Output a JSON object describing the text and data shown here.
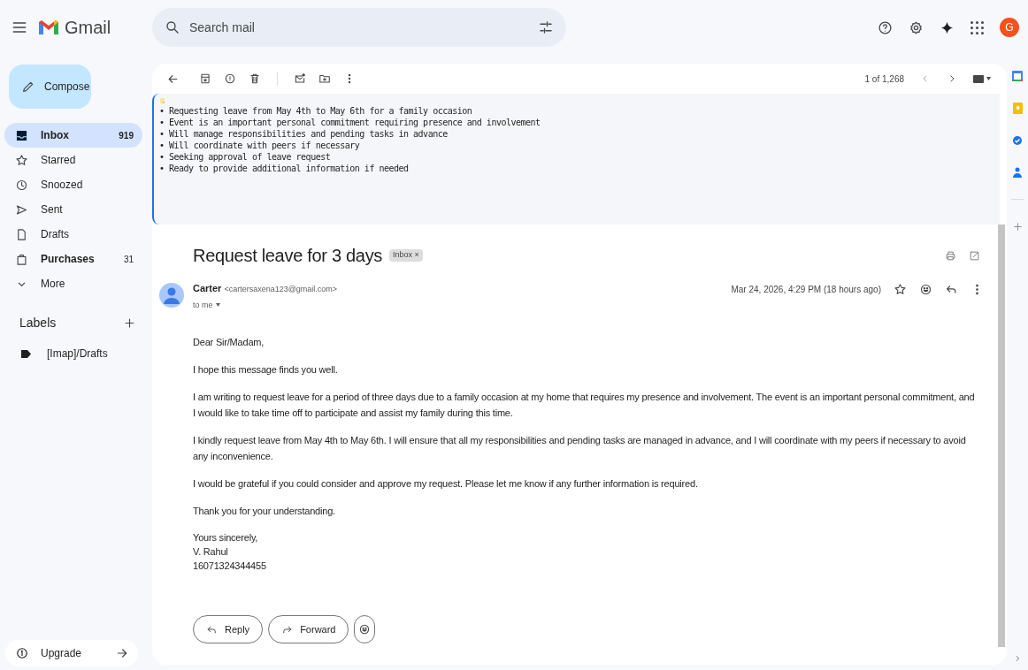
{
  "app": {
    "name": "Gmail",
    "avatar": "G"
  },
  "search": {
    "placeholder": "Search mail"
  },
  "compose": "Compose",
  "nav": [
    {
      "label": "Inbox",
      "count": "919",
      "selected": true,
      "unread": true
    },
    {
      "label": "Starred",
      "selected": false,
      "unread": false
    },
    {
      "label": "Snoozed",
      "selected": false,
      "unread": false
    },
    {
      "label": "Sent",
      "selected": false,
      "unread": false
    },
    {
      "label": "Drafts",
      "selected": false,
      "unread": false
    },
    {
      "label": "Purchases",
      "count": "31",
      "selected": false,
      "unread": true
    },
    {
      "label": "More",
      "selected": false,
      "unread": false
    }
  ],
  "labels": {
    "title": "Labels",
    "items": [
      "[Imap]/Drafts"
    ]
  },
  "upgrade": "Upgrade",
  "pager": "1 of 1,268",
  "summary": [
    "• Requesting leave from May 4th to May 6th for a family occasion",
    "• Event is an important personal commitment requiring presence and involvement",
    "• Will manage responsibilities and pending tasks in advance",
    "• Will coordinate with peers if necessary",
    "• Seeking approval of leave request",
    "• Ready to provide additional information if needed"
  ],
  "email": {
    "subject": "Request leave for 3 days",
    "label": "Inbox",
    "label_remove": "×",
    "sender": "Carter",
    "address": "<cartersaxena123@gmail.com>",
    "to": "to me",
    "date": "Mar 24, 2026, 4:29 PM (18 hours ago)",
    "starred": false,
    "body": [
      "Dear Sir/Madam,",
      "I hope this message finds you well.",
      "I am writing to request leave for a period of three days due to a family occasion at my home that requires my presence and involvement. The event is an important personal commitment, and I would like to take time off to participate and assist my family during this time.",
      "I kindly request leave from May 4th to May 6th. I will ensure that all my responsibilities and pending tasks are managed in advance, and I will coordinate with my peers if necessary to avoid any inconvenience.",
      "I would be grateful if you could consider and approve my request. Please let me know if any further information is required.",
      "Thank you for your understanding."
    ],
    "signature": [
      "Yours sincerely,",
      "V. Rahul",
      "16071324344455"
    ]
  },
  "actions": [
    "Reply",
    "Forward"
  ]
}
